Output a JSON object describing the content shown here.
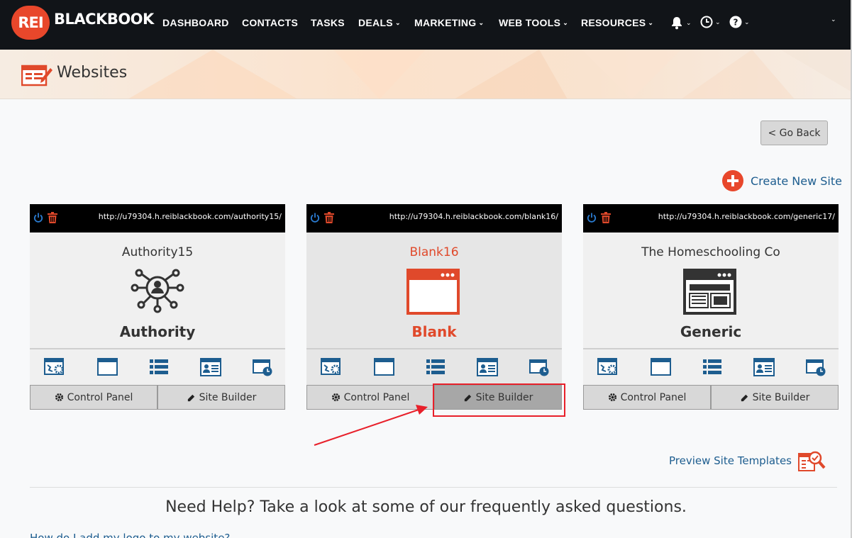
{
  "brand": {
    "badge": "REI",
    "name": "BLACKBOOK"
  },
  "nav": {
    "items": [
      {
        "label": "DASHBOARD",
        "dropdown": false
      },
      {
        "label": "CONTACTS",
        "dropdown": false
      },
      {
        "label": "TASKS",
        "dropdown": false
      },
      {
        "label": "DEALS",
        "dropdown": true
      },
      {
        "label": "MARKETING",
        "dropdown": true
      },
      {
        "label": "WEB TOOLS",
        "dropdown": true
      },
      {
        "label": "RESOURCES",
        "dropdown": true
      }
    ],
    "icons": [
      "bell-icon",
      "clock-icon",
      "help-icon",
      "user-menu-icon"
    ],
    "caret": "⌄"
  },
  "header": {
    "title": "Websites"
  },
  "actions": {
    "go_back": "< Go Back",
    "create_new": "Create New Site",
    "preview_templates": "Preview Site Templates"
  },
  "sites": [
    {
      "url": "http://u79304.h.reiblackbook.com/authority15/",
      "name": "Authority15",
      "type": "Authority",
      "icon": "network-person-icon",
      "active": false
    },
    {
      "url": "http://u79304.h.reiblackbook.com/blank16/",
      "name": "Blank16",
      "type": "Blank",
      "icon": "blank-window-icon",
      "active": true
    },
    {
      "url": "http://u79304.h.reiblackbook.com/generic17/",
      "name": "The Homeschooling Co",
      "type": "Generic",
      "icon": "generic-page-icon",
      "active": false
    }
  ],
  "card_buttons": {
    "control_panel": "Control Panel",
    "site_builder": "Site Builder"
  },
  "tools": [
    "site-settings-icon",
    "window-icon",
    "list-icon",
    "contact-card-icon",
    "analytics-icon"
  ],
  "help": {
    "title": "Need Help? Take a look at some of our frequently asked questions.",
    "faq_first": "How do I add my logo to my website?"
  },
  "colors": {
    "accent": "#e8472b",
    "link": "#1d5d8f",
    "nav_bg": "#111418",
    "highlight_box": "#e8202a"
  }
}
